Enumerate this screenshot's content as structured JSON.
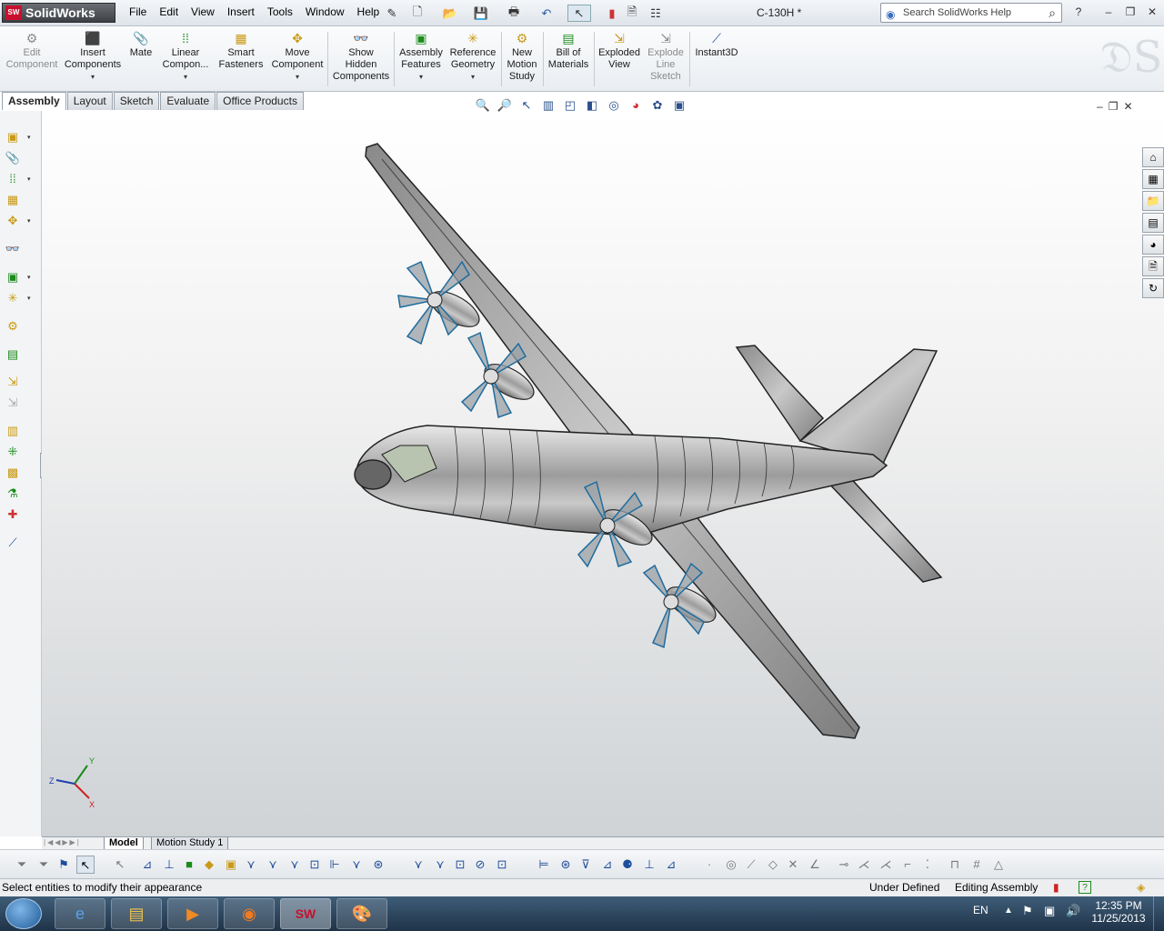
{
  "app": {
    "brand": "SolidWorks",
    "doc_title": "C-130H *"
  },
  "menu": [
    "File",
    "Edit",
    "View",
    "Insert",
    "Tools",
    "Window",
    "Help"
  ],
  "search": {
    "placeholder": "Search SolidWorks Help"
  },
  "commands": [
    {
      "label": "Edit\nComponent",
      "icon": "edit-component-icon",
      "enabled": false
    },
    {
      "label": "Insert\nComponents",
      "icon": "insert-components-icon",
      "enabled": true,
      "dropdown": true
    },
    {
      "label": "Mate",
      "icon": "mate-icon",
      "enabled": true
    },
    {
      "label": "Linear\nCompon...",
      "icon": "linear-pattern-icon",
      "enabled": true,
      "dropdown": true
    },
    {
      "label": "Smart\nFasteners",
      "icon": "smart-fasteners-icon",
      "enabled": true
    },
    {
      "label": "Move\nComponent",
      "icon": "move-component-icon",
      "enabled": true,
      "dropdown": true
    },
    {
      "label": "Show\nHidden\nComponents",
      "icon": "show-hidden-icon",
      "enabled": true
    },
    {
      "label": "Assembly\nFeatures",
      "icon": "assembly-features-icon",
      "enabled": true,
      "dropdown": true
    },
    {
      "label": "Reference\nGeometry",
      "icon": "reference-geometry-icon",
      "enabled": true,
      "dropdown": true
    },
    {
      "label": "New\nMotion\nStudy",
      "icon": "motion-study-icon",
      "enabled": true
    },
    {
      "label": "Bill of\nMaterials",
      "icon": "bom-icon",
      "enabled": true
    },
    {
      "label": "Exploded\nView",
      "icon": "exploded-view-icon",
      "enabled": true
    },
    {
      "label": "Explode\nLine\nSketch",
      "icon": "explode-line-icon",
      "enabled": false
    },
    {
      "label": "Instant3D",
      "icon": "instant3d-icon",
      "enabled": true
    }
  ],
  "tabs": [
    "Assembly",
    "Layout",
    "Sketch",
    "Evaluate",
    "Office Products"
  ],
  "active_tab": "Assembly",
  "model_tabs": [
    "Model",
    "Motion Study 1"
  ],
  "status": {
    "message": "Select entities to modify their appearance",
    "definition": "Under Defined",
    "mode": "Editing Assembly"
  },
  "tray": {
    "lang": "EN",
    "time": "12:35 PM",
    "date": "11/25/2013"
  },
  "triad": {
    "x": "X",
    "y": "Y",
    "z": "Z"
  }
}
